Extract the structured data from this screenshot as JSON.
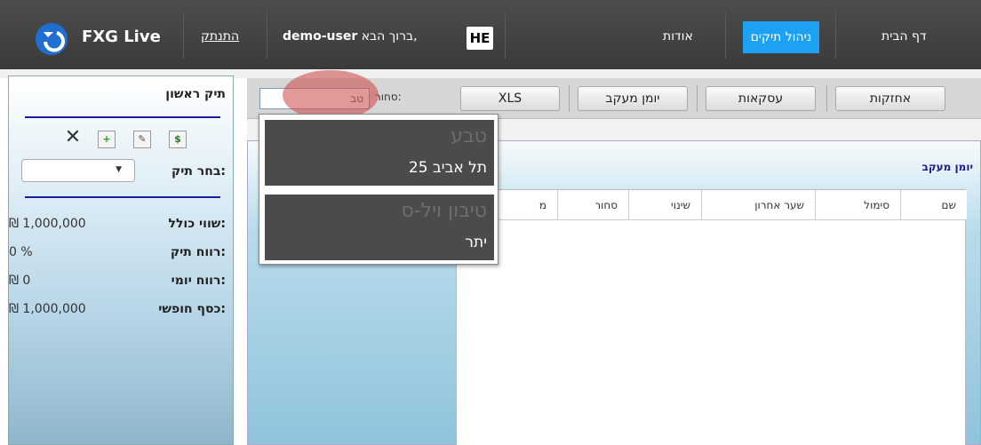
{
  "header": {
    "brand": "FXG Live",
    "logout": "התנתק",
    "welcome_prefix": "ברוך הבא,",
    "username": "demo-user",
    "language": "HE",
    "nav": [
      {
        "label": "אודות"
      },
      {
        "label": "ניהול תיקים",
        "active": true
      },
      {
        "label": "דף הבית"
      }
    ]
  },
  "sidebar": {
    "title": "תיק ראשון",
    "choose_label": "בחר תיק:",
    "choose_value": "",
    "stats": [
      {
        "label": "שווי כולל:",
        "value": "₪ 1,000,000"
      },
      {
        "label": "רווח תיק:",
        "value": "0 %"
      },
      {
        "label": "רווח יומי:",
        "value": "₪ 0"
      },
      {
        "label": "כסף חופשי:",
        "value": "₪ 1,000,000"
      }
    ],
    "tools": [
      "dollar-doc-icon",
      "edit-doc-icon",
      "add-doc-icon",
      "delete-icon"
    ]
  },
  "toolbar": {
    "buttons": [
      {
        "label": "אחזקות"
      },
      {
        "label": "עסקאות"
      },
      {
        "label": "יומן מעקב"
      },
      {
        "label": "XLS"
      }
    ],
    "search_label": "סחור:",
    "search_value": "טב"
  },
  "panel": {
    "title": "יומן מעקב",
    "columns": [
      "שם",
      "סימול",
      "שער אחרון",
      "שינוי",
      "סחור",
      "מ"
    ]
  },
  "autocomplete": {
    "items": [
      {
        "faded": "טבע",
        "name": "תל אביב 25"
      },
      {
        "faded": "טיבון ויל-ס",
        "name": "יתר"
      }
    ]
  },
  "colors": {
    "nav_bg": "#3f3f3f",
    "nav_active": "#1da1f2",
    "accent_line": "#1b1ba0",
    "logo": "#1e6fd0"
  }
}
